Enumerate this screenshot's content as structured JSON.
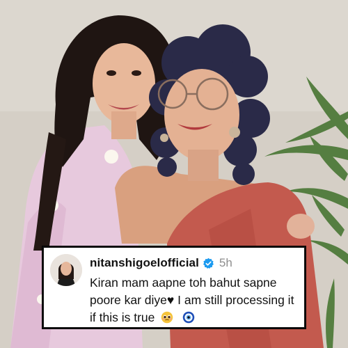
{
  "comment": {
    "username": "nitanshigoelofficial",
    "verified_icon": "verified-badge-icon",
    "timestamp": "5h",
    "text_before_heart": "Kiran mam aapne toh bahut sapne poore kar diye",
    "heart": "♥",
    "text_after_heart": " I am still processing it if this is true",
    "emojis": [
      "pleading-face-emoji",
      "nazar-amulet-emoji"
    ]
  },
  "colors": {
    "verified_blue": "#1d9bf0",
    "timestamp_gray": "#8e8e8e",
    "saree_red": "#c0574c",
    "lavender_dress": "#e6c6de",
    "wall": "#d6d0c7"
  }
}
